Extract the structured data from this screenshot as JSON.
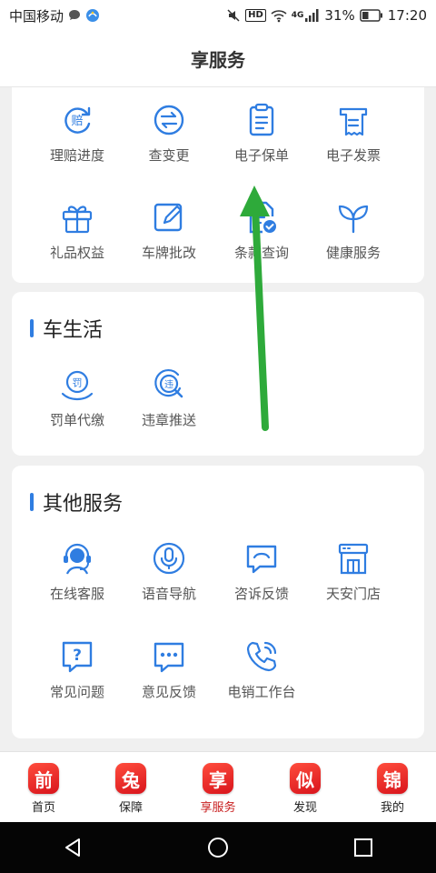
{
  "status": {
    "carrier": "中国移动",
    "hd": "HD",
    "network": "4G",
    "battery": "31%",
    "time": "17:20"
  },
  "header": {
    "title": "享服务"
  },
  "grid_top": [
    {
      "label": "理赔进度",
      "icon": "claim-icon"
    },
    {
      "label": "查变更",
      "icon": "swap-icon"
    },
    {
      "label": "电子保单",
      "icon": "clipboard-icon"
    },
    {
      "label": "电子发票",
      "icon": "invoice-icon"
    },
    {
      "label": "礼品权益",
      "icon": "gift-icon"
    },
    {
      "label": "车牌批改",
      "icon": "edit-icon"
    },
    {
      "label": "条款查询",
      "icon": "doc-check-icon"
    },
    {
      "label": "健康服务",
      "icon": "leaf-icon"
    }
  ],
  "car_life": {
    "title": "车生活",
    "items": [
      {
        "label": "罚单代缴",
        "icon_text": "罚",
        "icon": "fine-icon"
      },
      {
        "label": "违章推送",
        "icon_text": "违",
        "icon": "violation-icon"
      }
    ]
  },
  "other": {
    "title": "其他服务",
    "items": [
      {
        "label": "在线客服",
        "icon": "headset-icon"
      },
      {
        "label": "语音导航",
        "icon": "microphone-icon"
      },
      {
        "label": "咨诉反馈",
        "icon": "complaint-icon"
      },
      {
        "label": "天安门店",
        "icon": "store-icon"
      },
      {
        "label": "常见问题",
        "icon": "question-icon"
      },
      {
        "label": "意见反馈",
        "icon": "feedback-icon"
      },
      {
        "label": "电销工作台",
        "icon": "phone-icon"
      }
    ]
  },
  "tabs": [
    {
      "label": "首页",
      "glyph": "前"
    },
    {
      "label": "保障",
      "glyph": "兔"
    },
    {
      "label": "享服务",
      "glyph": "享"
    },
    {
      "label": "发现",
      "glyph": "似"
    },
    {
      "label": "我的",
      "glyph": "锦"
    }
  ],
  "colors": {
    "accent": "#2f7de1",
    "active_tab": "#c81e1e",
    "arrow": "#2eaa3a"
  }
}
